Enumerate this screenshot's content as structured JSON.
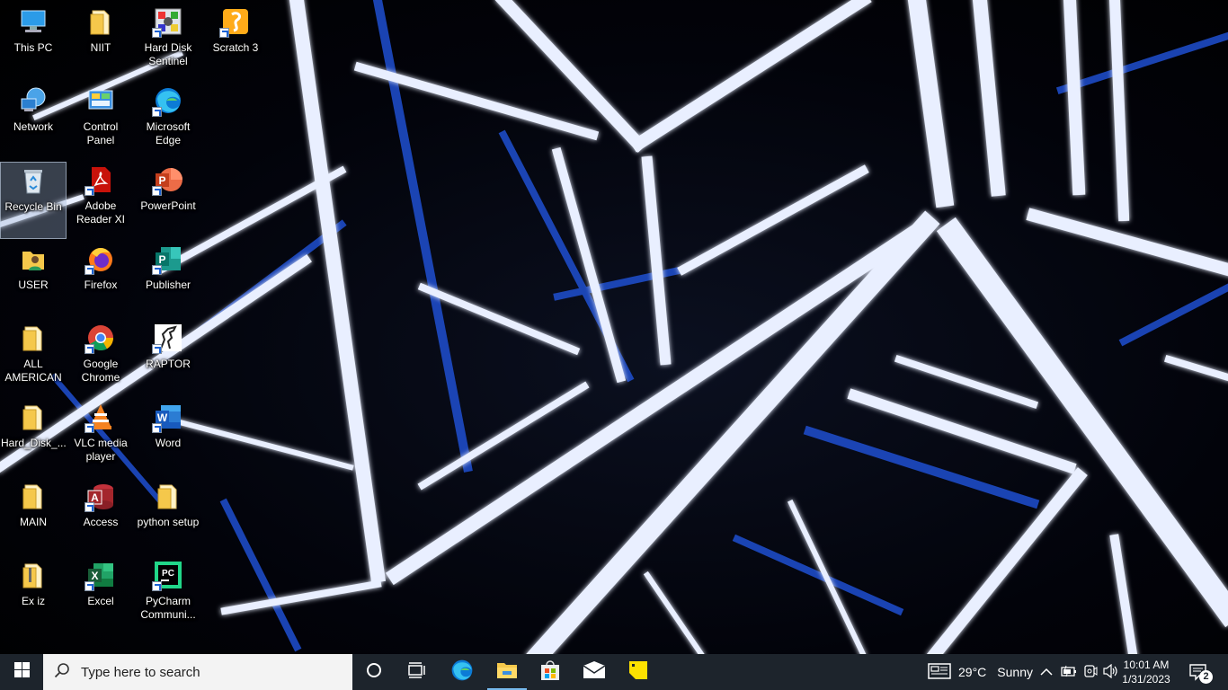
{
  "desktop": {
    "icons": [
      {
        "label": "This PC"
      },
      {
        "label": "Network"
      },
      {
        "label": "Recycle Bin"
      },
      {
        "label": "USER"
      },
      {
        "label": "ALL AMERICAN"
      },
      {
        "label": "Hard_Disk_..."
      },
      {
        "label": "MAIN"
      },
      {
        "label": "Ex iz"
      },
      {
        "label": "NIIT"
      },
      {
        "label": "Control Panel"
      },
      {
        "label": "Adobe Reader XI"
      },
      {
        "label": "Firefox"
      },
      {
        "label": "Google Chrome"
      },
      {
        "label": "VLC media player"
      },
      {
        "label": "Access"
      },
      {
        "label": "Excel"
      },
      {
        "label": "Hard Disk Sentinel"
      },
      {
        "label": "Microsoft Edge"
      },
      {
        "label": "PowerPoint"
      },
      {
        "label": "Publisher"
      },
      {
        "label": "RAPTOR"
      },
      {
        "label": "Word"
      },
      {
        "label": "python setup"
      },
      {
        "label": "PyCharm Communi..."
      },
      {
        "label": "Scratch 3"
      }
    ]
  },
  "taskbar": {
    "search_placeholder": "Type here to search",
    "weather_temp": "29°C",
    "weather_desc": "Sunny",
    "time": "10:01 AM",
    "date": "1/31/2023",
    "notification_count": "2"
  },
  "colors": {
    "taskbar_bg": "#1d242c",
    "accent": "#76b9ed",
    "search_bg": "#f3f3f3"
  }
}
